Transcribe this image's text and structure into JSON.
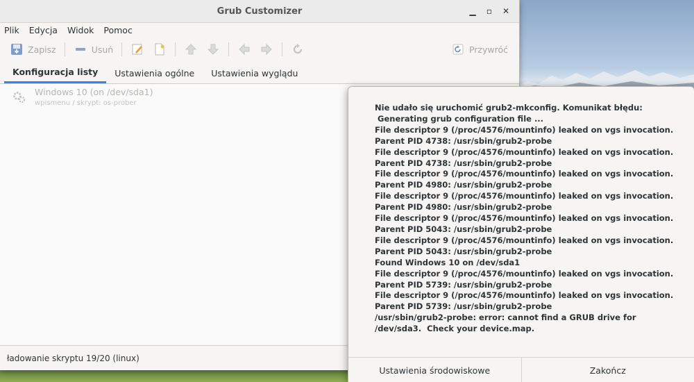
{
  "window": {
    "title": "Grub Customizer"
  },
  "menu": {
    "items": [
      "Plik",
      "Edycja",
      "Widok",
      "Pomoc"
    ]
  },
  "toolbar": {
    "save_label": "Zapisz",
    "remove_label": "Usuń",
    "restore_label": "Przywróć"
  },
  "tabs": [
    {
      "label": "Konfiguracja listy",
      "active": true
    },
    {
      "label": "Ustawienia ogólne",
      "active": false
    },
    {
      "label": "Ustawienia wyglądu",
      "active": false
    }
  ],
  "entries": [
    {
      "title": "Windows 10 (on /dev/sda1)",
      "subtitle": "wpismenu / skrypt: os-prober"
    }
  ],
  "status": {
    "text": "ładowanie skryptu 19/20 (linux)"
  },
  "dialog": {
    "message_lines": [
      "Nie udało się uruchomić grub2-mkconfig. Komunikat błędu:",
      " Generating grub configuration file ...",
      "File descriptor 9 (/proc/4576/mountinfo) leaked on vgs invocation. Parent PID 4738: /usr/sbin/grub2-probe",
      "File descriptor 9 (/proc/4576/mountinfo) leaked on vgs invocation. Parent PID 4738: /usr/sbin/grub2-probe",
      "File descriptor 9 (/proc/4576/mountinfo) leaked on vgs invocation. Parent PID 4980: /usr/sbin/grub2-probe",
      "File descriptor 9 (/proc/4576/mountinfo) leaked on vgs invocation. Parent PID 4980: /usr/sbin/grub2-probe",
      "File descriptor 9 (/proc/4576/mountinfo) leaked on vgs invocation. Parent PID 5043: /usr/sbin/grub2-probe",
      "File descriptor 9 (/proc/4576/mountinfo) leaked on vgs invocation. Parent PID 5043: /usr/sbin/grub2-probe",
      "Found Windows 10 on /dev/sda1",
      "File descriptor 9 (/proc/4576/mountinfo) leaked on vgs invocation. Parent PID 5739: /usr/sbin/grub2-probe",
      "File descriptor 9 (/proc/4576/mountinfo) leaked on vgs invocation. Parent PID 5739: /usr/sbin/grub2-probe",
      "/usr/sbin/grub2-probe: error: cannot find a GRUB drive for /dev/sda3.  Check your device.map."
    ],
    "env_button": "Ustawienia środowiskowe",
    "quit_button": "Zakończ"
  }
}
